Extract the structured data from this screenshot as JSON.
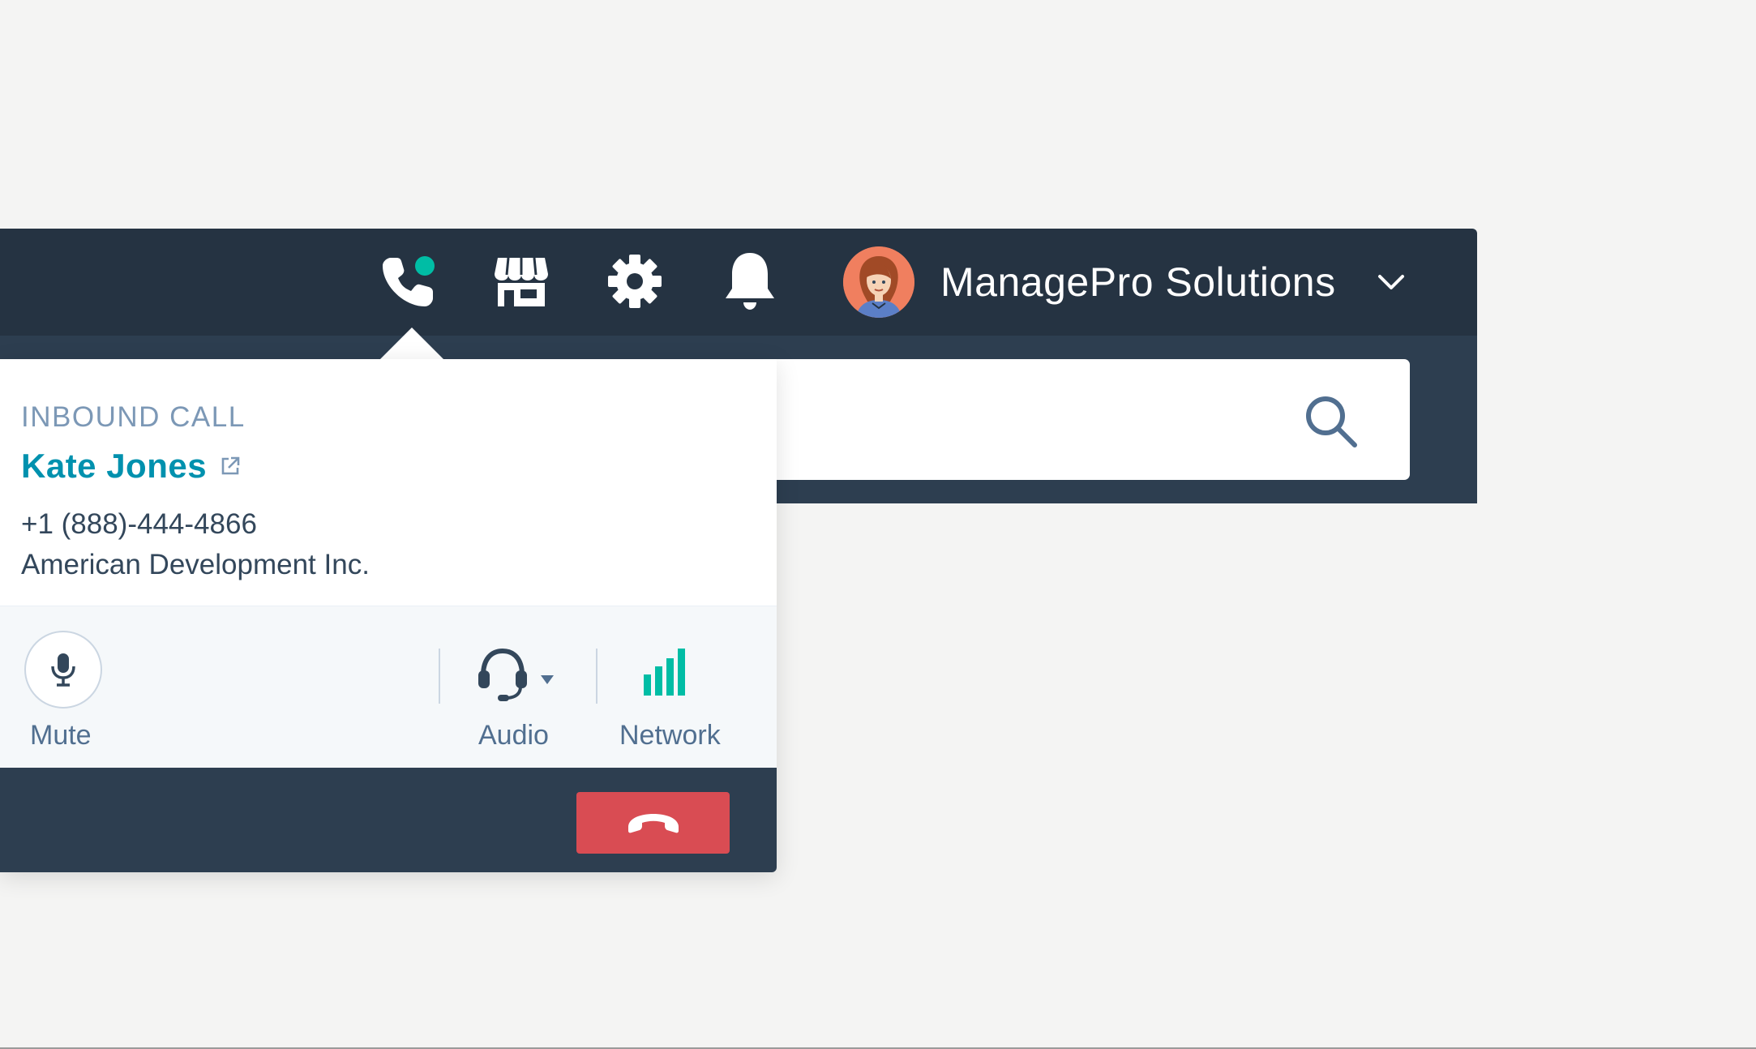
{
  "colors": {
    "nav_dark": "#253342",
    "subnav": "#2d3e50",
    "accent_teal": "#00bda5",
    "link": "#0091ae",
    "hangup_red": "#d94c53",
    "text_dark": "#33475b",
    "text_muted": "#7c98b6"
  },
  "nav": {
    "icons": [
      "calling-icon",
      "marketplace-icon",
      "settings-icon",
      "notifications-icon"
    ],
    "account": {
      "name": "ManagePro Solutions",
      "avatar_icon": "avatar-icon",
      "menu_icon": "chevron-down-icon"
    }
  },
  "search": {
    "icon": "search-icon"
  },
  "call": {
    "type": "INBOUND CALL",
    "contact_name": "Kate Jones",
    "contact_link_icon": "external-link-icon",
    "phone": "+1 (888)-444-4866",
    "company": "American Development Inc.",
    "controls": {
      "mute": "Mute",
      "audio": "Audio",
      "network": "Network"
    },
    "hangup_icon": "hang-up-icon"
  }
}
